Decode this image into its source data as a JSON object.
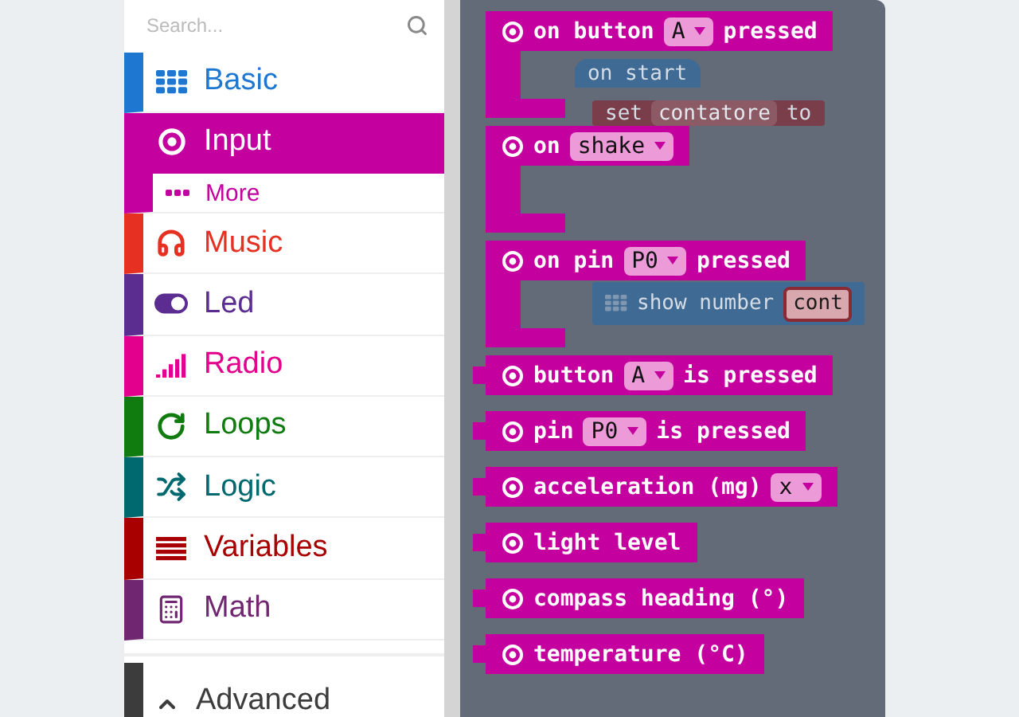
{
  "search": {
    "placeholder": "Search..."
  },
  "categories": [
    {
      "label": "Basic",
      "color": "#1e78d2",
      "selected": false
    },
    {
      "label": "Input",
      "color": "#c4009e",
      "selected": true,
      "children": [
        {
          "label": "More"
        }
      ]
    },
    {
      "label": "Music",
      "color": "#e63022",
      "selected": false
    },
    {
      "label": "Led",
      "color": "#5c2d91",
      "selected": false
    },
    {
      "label": "Radio",
      "color": "#e3008c",
      "selected": false
    },
    {
      "label": "Loops",
      "color": "#107c10",
      "selected": false
    },
    {
      "label": "Logic",
      "color": "#006970",
      "selected": false
    },
    {
      "label": "Variables",
      "color": "#a80000",
      "selected": false
    },
    {
      "label": "Math",
      "color": "#712672",
      "selected": false
    }
  ],
  "advanced": {
    "label": "Advanced",
    "color": "#3c3c3c"
  },
  "workspace": [
    {
      "kind": "event",
      "color": "#3f6a93",
      "parts": [
        {
          "kind": "text",
          "text": "on start"
        }
      ]
    },
    {
      "kind": "statement",
      "color": "#7a3e4a",
      "parts": [
        {
          "kind": "text",
          "text": "set"
        },
        {
          "kind": "dropdown",
          "text": "contatore"
        },
        {
          "kind": "text",
          "text": "to"
        }
      ]
    },
    {
      "kind": "statement",
      "color": "#3f6a93",
      "parts": [
        {
          "kind": "text",
          "text": "show number"
        },
        {
          "kind": "variable",
          "text": "cont"
        }
      ]
    }
  ],
  "flyout": [
    {
      "kind": "hat",
      "parts": [
        {
          "kind": "text",
          "text": "on button"
        },
        {
          "kind": "dropdown",
          "text": "A"
        },
        {
          "kind": "text",
          "text": "pressed"
        }
      ]
    },
    {
      "kind": "hat",
      "parts": [
        {
          "kind": "text",
          "text": "on"
        },
        {
          "kind": "dropdown",
          "text": "shake"
        }
      ]
    },
    {
      "kind": "hat",
      "parts": [
        {
          "kind": "text",
          "text": "on pin"
        },
        {
          "kind": "dropdown",
          "text": "P0"
        },
        {
          "kind": "text",
          "text": "pressed"
        }
      ]
    },
    {
      "kind": "reporter",
      "parts": [
        {
          "kind": "text",
          "text": "button"
        },
        {
          "kind": "dropdown",
          "text": "A"
        },
        {
          "kind": "text",
          "text": "is pressed"
        }
      ]
    },
    {
      "kind": "reporter",
      "parts": [
        {
          "kind": "text",
          "text": "pin"
        },
        {
          "kind": "dropdown",
          "text": "P0"
        },
        {
          "kind": "text",
          "text": "is pressed"
        }
      ]
    },
    {
      "kind": "reporter",
      "parts": [
        {
          "kind": "text",
          "text": "acceleration (mg)"
        },
        {
          "kind": "dropdown",
          "text": "x"
        }
      ]
    },
    {
      "kind": "reporter",
      "parts": [
        {
          "kind": "text",
          "text": "light level"
        }
      ]
    },
    {
      "kind": "reporter",
      "parts": [
        {
          "kind": "text",
          "text": "compass heading (°)"
        }
      ]
    },
    {
      "kind": "reporter",
      "parts": [
        {
          "kind": "text",
          "text": "temperature (°C)"
        }
      ]
    }
  ]
}
